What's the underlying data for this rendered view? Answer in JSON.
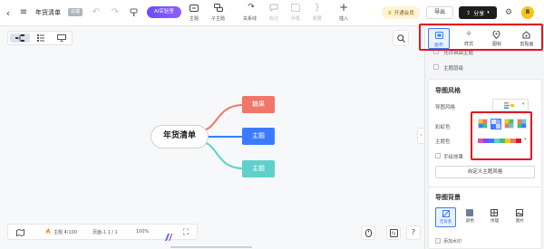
{
  "header": {
    "doc_title": "年货清单",
    "cloud_badge": "云端",
    "ai_button": "AI实验室",
    "toolbar": {
      "theme": "主题",
      "subtopic": "子主题",
      "relation": "关系线",
      "label": "标注",
      "outline": "外框",
      "summary": "概要",
      "insert": "插入"
    },
    "member": "开通会员",
    "export": "导出",
    "share": "分享",
    "avatar": "B"
  },
  "colors": {
    "accent": "#3b7cff",
    "red_node": "#f07668",
    "blue_node": "#3b7cff",
    "teal_node": "#5fd0cc",
    "highlight": "#e0181e",
    "ai_purple": "#7b4dff"
  },
  "mindmap": {
    "root": "年货清单",
    "children": [
      {
        "label": "糖果",
        "color": "#f07668"
      },
      {
        "label": "主题",
        "color": "#3b7cff"
      },
      {
        "label": "主题",
        "color": "#5fd0cc"
      }
    ]
  },
  "statusbar": {
    "topics": "主题 4/100",
    "page": "页面-1  1 / 1",
    "zoom": "100%"
  },
  "panel": {
    "tabs": [
      "画布",
      "样式",
      "图标",
      "剪贴画"
    ],
    "free_float": "允许自由主题",
    "theme_level": "主题层级",
    "style_heading": "导图风格",
    "style_label": "导图风格",
    "rainbow_label": "彩虹色",
    "theme_color_label": "主题色",
    "hand_drawn": "手绘效果",
    "custom_style_button": "自定义主题风格",
    "bg_heading": "导图背景",
    "bg_options": [
      "无背景",
      "颜色",
      "纹理",
      "图片"
    ],
    "watermark": "添加水印"
  },
  "icons": {
    "back": "chevron-left-icon",
    "menu": "hamburger-icon",
    "undo": "undo-icon",
    "redo": "redo-icon",
    "format_painter": "format-painter-icon",
    "search": "search-icon",
    "help": "help-icon"
  }
}
